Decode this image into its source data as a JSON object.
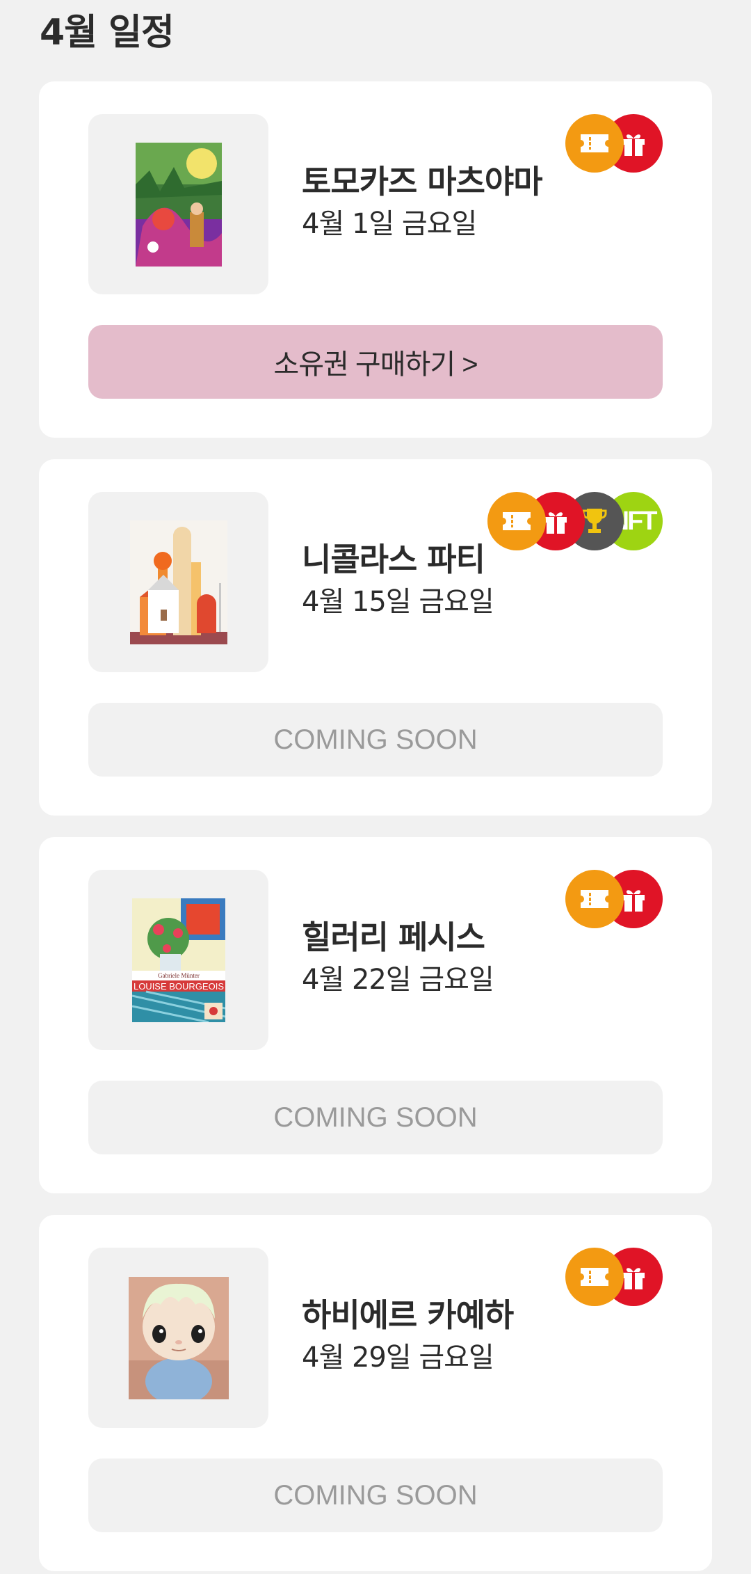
{
  "page": {
    "heading": "4월 일정"
  },
  "colors": {
    "background": "#f1f1f1",
    "card": "#ffffff",
    "buy_button": "#e4bccb",
    "coming_soon_button": "#f1f1f1",
    "coming_soon_text": "#9a9a9a",
    "badge_ticket": "#f39a12",
    "badge_gift": "#e01426",
    "badge_trophy": "#555555",
    "badge_nft": "#9ed412"
  },
  "events": [
    {
      "title": "토모카즈 마츠야마",
      "date": "4월 1일 금요일",
      "button_label": "소유권 구매하기 >",
      "button_state": "available",
      "badges": [
        "ticket-icon",
        "gift-icon"
      ]
    },
    {
      "title": "니콜라스 파티",
      "date": "4월 15일 금요일",
      "button_label": "COMING SOON",
      "button_state": "disabled",
      "badges": [
        "ticket-icon",
        "gift-icon",
        "trophy-icon",
        "nft-icon"
      ],
      "nft_label": "NFT"
    },
    {
      "title": "힐러리 페시스",
      "date": "4월 22일 금요일",
      "button_label": "COMING SOON",
      "button_state": "disabled",
      "badges": [
        "ticket-icon",
        "gift-icon"
      ]
    },
    {
      "title": "하비에르 카예하",
      "date": "4월 29일 금요일",
      "button_label": "COMING SOON",
      "button_state": "disabled",
      "badges": [
        "ticket-icon",
        "gift-icon"
      ]
    }
  ],
  "artwork_text": {
    "event_3_book_title": "LOUISE BOURGEOIS",
    "event_3_book_author": "Gabriele Münter"
  }
}
